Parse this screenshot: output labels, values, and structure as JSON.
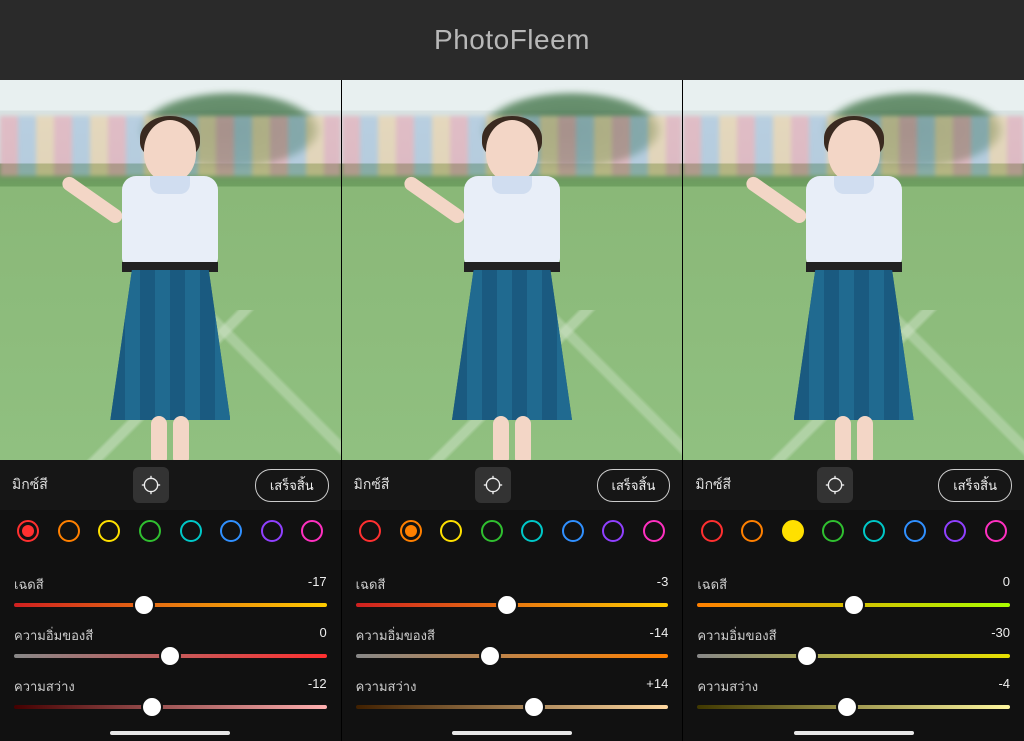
{
  "header": {
    "title": "PhotoFleem"
  },
  "labels": {
    "mix": "มิกซ์สี",
    "done": "เสร็จสิ้น",
    "hue": "เฉดสี",
    "saturation": "ความอิ่มของสี",
    "luminance": "ความสว่าง"
  },
  "swatch_colors": [
    "#ff3030",
    "#ff8000",
    "#ffe000",
    "#30c030",
    "#00c8c8",
    "#3090ff",
    "#9040ff",
    "#ff30c0"
  ],
  "panels": [
    {
      "selected_swatch_index": 0,
      "selected_style": "dot",
      "sliders": {
        "hue": {
          "value": -17,
          "display": "-17",
          "grad": "g-orange"
        },
        "saturation": {
          "value": 0,
          "display": "0",
          "grad": "g-satR"
        },
        "luminance": {
          "value": -12,
          "display": "-12",
          "grad": "g-lumR"
        }
      }
    },
    {
      "selected_swatch_index": 1,
      "selected_style": "dot",
      "sliders": {
        "hue": {
          "value": -3,
          "display": "-3",
          "grad": "g-orange"
        },
        "saturation": {
          "value": -14,
          "display": "-14",
          "grad": "g-satO"
        },
        "luminance": {
          "value": 14,
          "display": "+14",
          "grad": "g-lumO"
        }
      }
    },
    {
      "selected_swatch_index": 2,
      "selected_style": "solid",
      "sliders": {
        "hue": {
          "value": 0,
          "display": "0",
          "grad": "g-yellow"
        },
        "saturation": {
          "value": -30,
          "display": "-30",
          "grad": "g-satY"
        },
        "luminance": {
          "value": -4,
          "display": "-4",
          "grad": "g-lumY"
        }
      }
    }
  ]
}
